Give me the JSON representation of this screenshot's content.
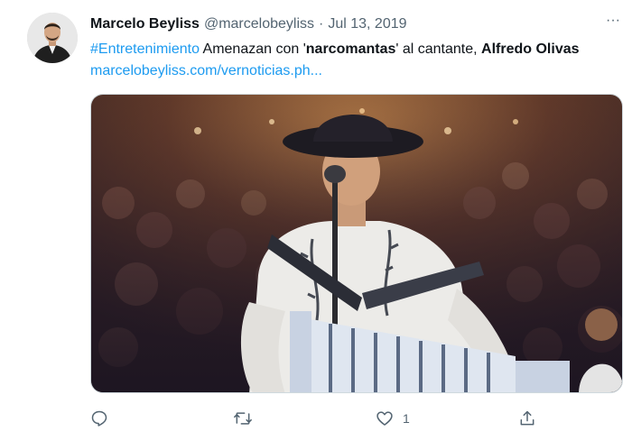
{
  "tweet": {
    "author": {
      "display_name": "Marcelo Beyliss",
      "handle": "@marcelobeyliss",
      "separator": "·",
      "date": "Jul 13, 2019"
    },
    "more_label": "···",
    "text": {
      "hashtag": "#Entretenimiento",
      "part1": " Amenazan con '",
      "bold1": "narcomantas",
      "part2": "' al cantante, ",
      "bold2": "Alfredo Olivas",
      "link": "marcelobeyliss.com/vernoticias.ph..."
    },
    "media": {
      "icon": "photo-singer-accordion"
    },
    "actions": {
      "reply": {
        "icon": "reply-icon",
        "count": ""
      },
      "retweet": {
        "icon": "retweet-icon",
        "count": ""
      },
      "like": {
        "icon": "heart-icon",
        "count": "1"
      },
      "share": {
        "icon": "share-icon",
        "count": ""
      }
    }
  },
  "colors": {
    "link": "#1d9bf0",
    "secondary_text": "#536471",
    "primary_text": "#0f1419"
  }
}
